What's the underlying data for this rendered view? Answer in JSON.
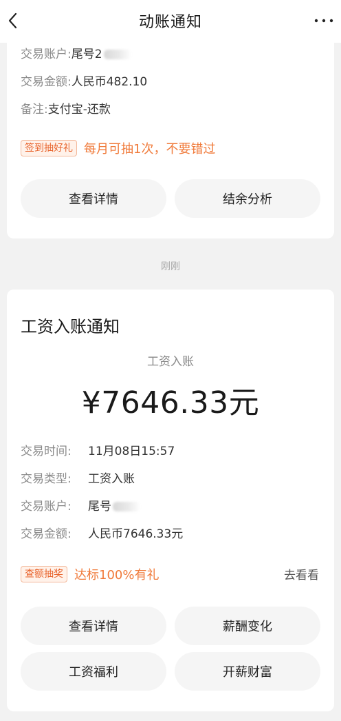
{
  "nav": {
    "title": "动账通知"
  },
  "card1": {
    "account_label": "交易账户:",
    "account_value": "尾号2",
    "amount_label": "交易金额:",
    "amount_value": "人民币482.10",
    "note_label": "备注:",
    "note_value": "支付宝-还款",
    "badge": "签到抽好礼",
    "promo_text": "每月可抽1次，不要错过",
    "buttons": [
      "查看详情",
      "结余分析"
    ]
  },
  "time_label": "刚刚",
  "card2": {
    "title": "工资入账通知",
    "subtitle": "工资入账",
    "amount": "¥7646.33元",
    "rows": [
      {
        "label": "交易时间:",
        "value": "11月08日15:57"
      },
      {
        "label": "交易类型:",
        "value": "工资入账"
      },
      {
        "label": "交易账户:",
        "value": "尾号"
      },
      {
        "label": "交易金额:",
        "value": "人民币7646.33元"
      }
    ],
    "badge": "查额抽奖",
    "promo_text": "达标100%有礼",
    "go_see": "去看看",
    "buttons": [
      "查看详情",
      "薪酬变化",
      "工资福利",
      "开薪财富"
    ]
  },
  "colors": {
    "accent_orange": "#f07a3a",
    "badge_bg": "#fff2ea",
    "page_bg": "#f2f2f2"
  },
  "icons": [
    "back-arrow-icon",
    "more-dots-icon"
  ]
}
